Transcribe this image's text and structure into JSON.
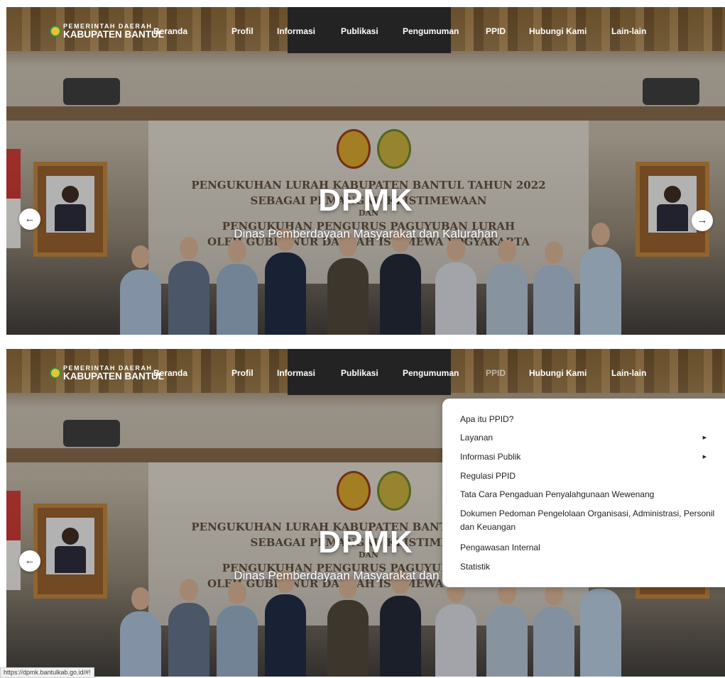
{
  "header": {
    "logo_line1": "PEMERINTAH DAERAH",
    "logo_line2": "KABUPATEN BANTUL"
  },
  "nav": {
    "items": [
      "Beranda",
      "Profil",
      "Informasi",
      "Publikasi",
      "Pengumuman",
      "PPID",
      "Hubungi Kami",
      "Lain-lain"
    ]
  },
  "hero": {
    "title": "DPMK",
    "subtitle": "Dinas Pemberdayaan Masyarakat dan Kalurahan",
    "prev_icon": "arrow-left-icon",
    "next_icon": "arrow-right-icon"
  },
  "photo_banner": {
    "line1": "PENGUKUHAN LURAH KABUPATEN BANTUL TAHUN 2022",
    "line2": "SEBAGAI PEMANGKU KEISTIMEWAAN",
    "line3": "DAN",
    "line4": "PENGUKUHAN PENGURUS PAGUYUBAN LURAH",
    "line5": "OLEH GUBERNUR DAERAH ISTIMEWA YOGYAKARTA"
  },
  "ppid_menu": {
    "items": [
      {
        "label": "Apa itu PPID?",
        "submenu": false
      },
      {
        "label": "Layanan",
        "submenu": true
      },
      {
        "label": "Informasi Publik",
        "submenu": true
      },
      {
        "label": "Regulasi PPID",
        "submenu": false
      },
      {
        "label": "Tata Cara Pengaduan Penyalahgunaan Wewenang",
        "submenu": false
      },
      {
        "label": "Dokumen Pedoman Pengelolaan Organisasi, Administrasi, Personil dan Keuangan",
        "submenu": false
      },
      {
        "label": "Pengawasan Internal",
        "submenu": false
      },
      {
        "label": "Statistik",
        "submenu": false
      }
    ],
    "caret_icon": "caret-right-icon"
  },
  "status_bar": {
    "url": "https://dpmk.bantulkab.go.id/#!"
  },
  "colors": {
    "nav_text": "#ffffff",
    "dropdown_bg": "#ffffff",
    "logo_gold": "#e2c33a"
  }
}
